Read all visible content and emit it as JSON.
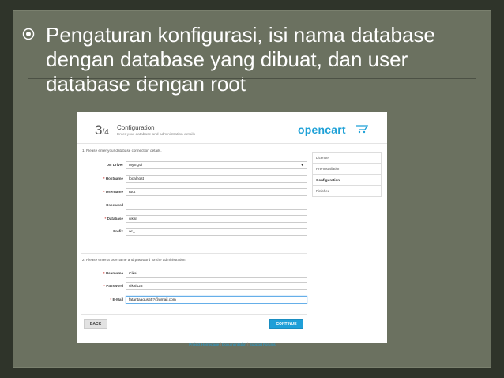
{
  "slide": {
    "bullet_text": "Pengaturan konfigurasi, isi nama database dengan database yang dibuat, dan user database dengan root"
  },
  "installer": {
    "step_number": "3",
    "step_total": "/4",
    "title": "Configuration",
    "subtitle": "Enter your database and administration details",
    "logo_text": "opencart",
    "section1": "1. Please enter your database connection details.",
    "section2": "2. Please enter a username and password for the administration.",
    "db_fields": [
      {
        "label": "DB Driver",
        "required": "",
        "value": "MySQLi"
      },
      {
        "label": "Hostname",
        "required": "*",
        "value": "localhost"
      },
      {
        "label": "Username",
        "required": "*",
        "value": "root"
      },
      {
        "label": "Password",
        "required": "",
        "value": ""
      },
      {
        "label": "Database",
        "required": "*",
        "value": "cikal"
      },
      {
        "label": "Prefix",
        "required": "",
        "value": "oc_"
      }
    ],
    "admin_fields": [
      {
        "label": "Username",
        "required": "*",
        "value": "Cikal"
      },
      {
        "label": "Password",
        "required": "*",
        "value": "cikal123"
      },
      {
        "label": "E-Mail",
        "required": "*",
        "value": "fatantaagus55?@gmail.com"
      }
    ],
    "sidebar": [
      "License",
      "Pre-Installation",
      "Configuration",
      "Finished"
    ],
    "back_label": "BACK",
    "continue_label": "CONTINUE",
    "footer": {
      "link1": "Project Homepage",
      "sep": "|",
      "link2": "Documentation",
      "link3": "Support Forums"
    }
  }
}
